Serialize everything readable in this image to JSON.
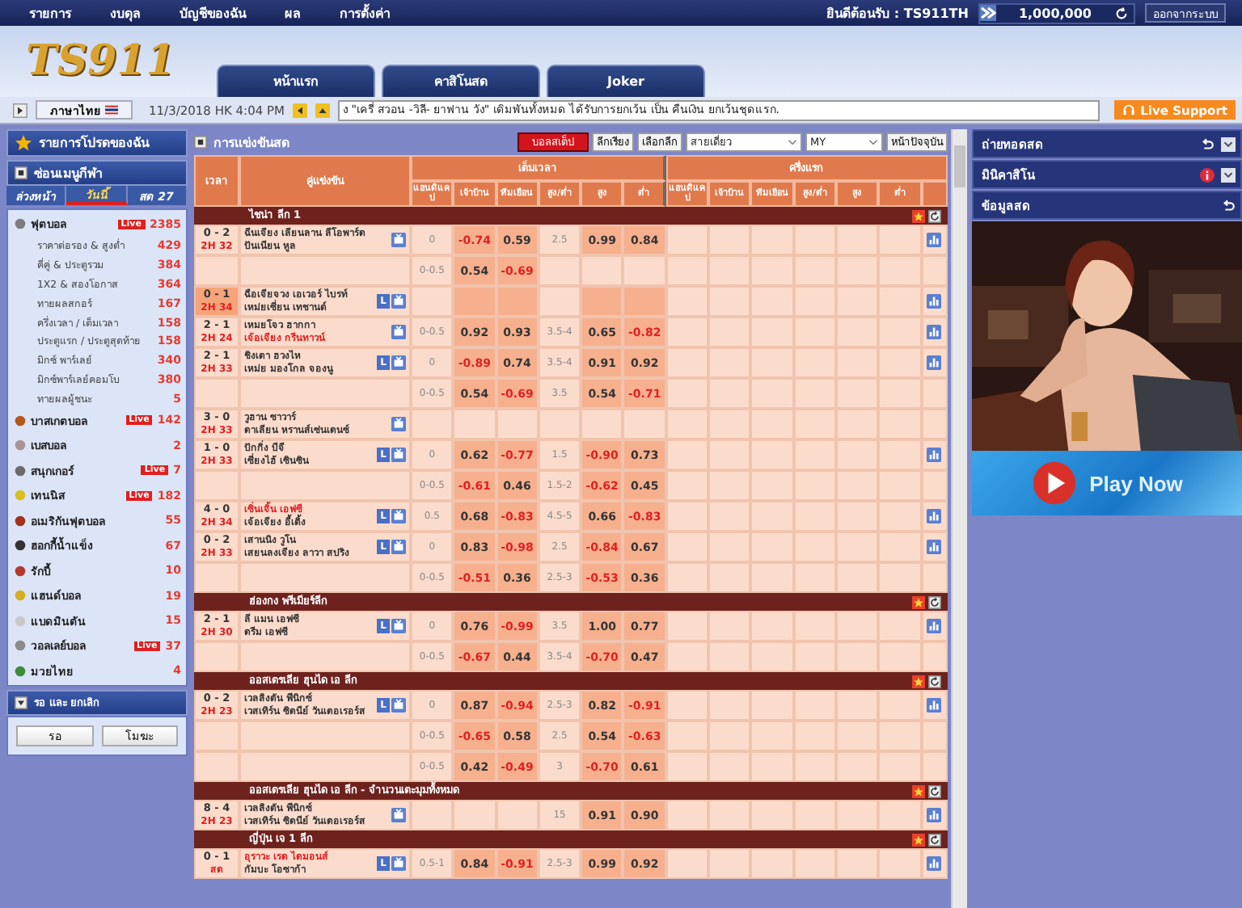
{
  "top_nav": {
    "items": [
      "รายการ",
      "งบดุล",
      "บัญชีของฉัน",
      "ผล",
      "การตั้งค่า"
    ],
    "welcome": "ยินดีต้อนรับ : TS911TH",
    "balance": "1,000,000",
    "logout": "ออกจากระบบ"
  },
  "logo": "TS911",
  "tabs": [
    {
      "label": "หน้าแรก"
    },
    {
      "label": "คาสิโนสด"
    },
    {
      "label": "Joker"
    }
  ],
  "ticker_bar": {
    "language": "ภาษาไทย",
    "datetime": "11/3/2018 HK 4:04 PM",
    "message": "ง \"เครี่ สวอน -วิลี- ยาฟาน วัง\" เดิมพันทั้งหมด ได้รับการยกเว้น เป็น คืนเงิน ยกเว้นชุดแรก.",
    "support": "Live Support"
  },
  "sidebar": {
    "favorites": "รายการโปรดของฉัน",
    "hide_menu": "ซ่อนเมนูกีฬา",
    "tabs": [
      {
        "label": "ล่วงหน้า",
        "selected": false
      },
      {
        "label": "วันนี้",
        "selected": true
      },
      {
        "label": "สด 27",
        "selected": false
      }
    ],
    "sports": [
      {
        "name": "ฟุตบอล",
        "count": "2385",
        "live": "Live",
        "color": "#7d7d7d",
        "children": [
          {
            "name": "ราคาต่อรอง & สูงต่ำ",
            "count": "429"
          },
          {
            "name": "คี่คู่ & ประตูรวม",
            "count": "384"
          },
          {
            "name": "1X2 & สองโอกาส",
            "count": "364"
          },
          {
            "name": "ทายผลสกอร์",
            "count": "167"
          },
          {
            "name": "ครึ่งเวลา / เต็มเวลา",
            "count": "158"
          },
          {
            "name": "ประตูแรก / ประตูสุดท้าย",
            "count": "158"
          },
          {
            "name": "มิกซ์ พาร์เลย์",
            "count": "340"
          },
          {
            "name": "มิกซ์พาร์เลย์คอมโบ",
            "count": "380"
          },
          {
            "name": "ทายผลผู้ชนะ",
            "count": "5"
          }
        ]
      },
      {
        "name": "บาสเกตบอล",
        "count": "142",
        "live": "Live",
        "color": "#b4561c"
      },
      {
        "name": "เบสบอล",
        "count": "2",
        "color": "#a89494"
      },
      {
        "name": "สนุกเกอร์",
        "count": "7",
        "live": "Live",
        "color": "#6b6b6b"
      },
      {
        "name": "เทนนิส",
        "count": "182",
        "live": "Live",
        "color": "#d8bf22"
      },
      {
        "name": "อเมริกันฟุตบอล",
        "count": "55",
        "color": "#a2321c"
      },
      {
        "name": "ฮอกกี้น้ำแข็ง",
        "count": "67",
        "color": "#333333"
      },
      {
        "name": "รักบี้",
        "count": "10",
        "color": "#b23a2e"
      },
      {
        "name": "แฮนด์บอล",
        "count": "19",
        "color": "#d9ad22"
      },
      {
        "name": "แบดมินตัน",
        "count": "15",
        "color": "#c8c8c8"
      },
      {
        "name": "วอลเลย์บอล",
        "count": "37",
        "live": "Live",
        "color": "#8c8c8c"
      },
      {
        "name": "มวยไทย",
        "count": "4",
        "color": "#3f8a3a"
      }
    ],
    "pending": {
      "title": "รอ และ ยกเลิก",
      "buttons": [
        "รอ",
        "โมฆะ"
      ]
    }
  },
  "main": {
    "title": "การแข่งขันสด",
    "toolbar": {
      "parlay": "บอลสเต็ป",
      "sort": "ลีกเรียง",
      "select_league": "เลือกลีก",
      "view": "สายเดี่ยว",
      "odds_type": "MY",
      "current_page": "หน้าปัจจุบัน"
    },
    "table": {
      "columns": [
        "เวลา",
        "คู่แข่งขัน"
      ],
      "groups": [
        {
          "label": "เต็มเวลา",
          "columns": [
            "แฮนดิแคป",
            "เจ้าบ้าน",
            "ทีมเยือน",
            "สูง/ต่ำ",
            "สูง",
            "ต่ำ"
          ]
        },
        {
          "label": "ครึ่งแรก",
          "columns": [
            "แฮนดิแคป",
            "เจ้าบ้าน",
            "ทีมเยือน",
            "สูง/ต่ำ",
            "สูง",
            "ต่ำ"
          ]
        }
      ],
      "leagues": [
        {
          "name": "ไชน่า ลีก 1",
          "matches": [
            {
              "score": "0 - 2",
              "time": "2H 32",
              "score_hl": false,
              "home": "ฉีนเจียง เลียนลาน ลีโอพาร์ด",
              "away": "ปันเนียน หูล",
              "home_red": false,
              "away_red": false,
              "lines": [
                {
                  "hdp": "0",
                  "home": "-0.74",
                  "away": "0.59",
                  "ou": "2.5",
                  "over": "0.99",
                  "under": "0.84"
                },
                {
                  "hdp": "0-0.5",
                  "home": "0.54",
                  "away": "-0.69"
                }
              ]
            },
            {
              "score": "0 - 1",
              "time": "2H 34",
              "score_hl": true,
              "home": "ฉือเจียจวง เอเวอร์ ไบรท์",
              "away": "เหม่ยเซี่ยน เทชานต์",
              "home_red": false,
              "away_red": false,
              "l": "L"
            },
            {
              "score": "2 - 1",
              "time": "2H 24",
              "score_hl": false,
              "home": "เหมยโจว ฮากกา",
              "away": "เจ้อเจียง กรีนทาวน์",
              "home_red": false,
              "away_red": true,
              "lines": [
                {
                  "hdp": "0-0.5",
                  "home": "0.92",
                  "away": "0.93",
                  "ou": "3.5-4",
                  "over": "0.65",
                  "under": "-0.82"
                }
              ]
            },
            {
              "score": "2 - 1",
              "time": "2H 33",
              "score_hl": false,
              "home": "ชิงเตา ฮวงไห",
              "away": "เหม่ย มองโกล จองนู",
              "home_red": false,
              "away_red": false,
              "l": "L",
              "lines": [
                {
                  "hdp": "0",
                  "home": "-0.89",
                  "away": "0.74",
                  "ou": "3.5-4",
                  "over": "0.91",
                  "under": "0.92"
                },
                {
                  "hdp": "0-0.5",
                  "home": "0.54",
                  "away": "-0.69",
                  "ou": "3.5",
                  "over": "0.54",
                  "under": "-0.71"
                }
              ]
            },
            {
              "score": "3 - 0",
              "time": "2H 33",
              "score_hl": false,
              "home": "วูฮาน ซาวาร์",
              "away": "ดาเลียน หรานส์เซ่นเดนซ์",
              "home_red": false,
              "away_red": false
            },
            {
              "score": "1 - 0",
              "time": "2H 33",
              "score_hl": false,
              "home": "ปักกิ่ง บีจี",
              "away": "เซี่ยงไฮ้ เซินซิน",
              "home_red": false,
              "away_red": false,
              "l": "L",
              "lines": [
                {
                  "hdp": "0",
                  "home": "0.62",
                  "away": "-0.77",
                  "ou": "1.5",
                  "over": "-0.90",
                  "under": "0.73"
                },
                {
                  "hdp": "0-0.5",
                  "home": "-0.61",
                  "away": "0.46",
                  "ou": "1.5-2",
                  "over": "-0.62",
                  "under": "0.45"
                }
              ]
            },
            {
              "score": "4 - 0",
              "time": "2H 34",
              "score_hl": false,
              "home": "เซิ่นเจิ้น เอฟซี",
              "away": "เจ้อเจียง อี้เติ้ง",
              "home_red": true,
              "away_red": false,
              "l": "L",
              "lines": [
                {
                  "hdp": "0.5",
                  "home": "0.68",
                  "away": "-0.83",
                  "ou": "4.5-5",
                  "over": "0.66",
                  "under": "-0.83"
                }
              ]
            },
            {
              "score": "0 - 2",
              "time": "2H 33",
              "score_hl": false,
              "home": "เสานนิง วูโน",
              "away": "เสยนลงเจียง ลาวา สปริง",
              "home_red": false,
              "away_red": false,
              "l": "L",
              "lines": [
                {
                  "hdp": "0",
                  "home": "0.83",
                  "away": "-0.98",
                  "ou": "2.5",
                  "over": "-0.84",
                  "under": "0.67"
                },
                {
                  "hdp": "0-0.5",
                  "home": "-0.51",
                  "away": "0.36",
                  "ou": "2.5-3",
                  "over": "-0.53",
                  "under": "0.36"
                }
              ]
            }
          ]
        },
        {
          "name": "ฮ่องกง พรีเมียร์ลีก",
          "matches": [
            {
              "score": "2 - 1",
              "time": "2H 30",
              "score_hl": false,
              "home": "ลี แมน เอฟซี",
              "away": "ดรีม เอฟซี",
              "home_red": false,
              "away_red": false,
              "l": "L",
              "lines": [
                {
                  "hdp": "0",
                  "home": "0.76",
                  "away": "-0.99",
                  "ou": "3.5",
                  "over": "1.00",
                  "under": "0.77"
                },
                {
                  "hdp": "0-0.5",
                  "home": "-0.67",
                  "away": "0.44",
                  "ou": "3.5-4",
                  "over": "-0.70",
                  "under": "0.47"
                }
              ]
            }
          ]
        },
        {
          "name": "ออสเตรเลีย ฮุนได เอ ลีก",
          "matches": [
            {
              "score": "0 - 2",
              "time": "2H 23",
              "score_hl": false,
              "home": "เวลลิงตัน ฟีนิกซ์",
              "away": "เวสเทิร์น ซิดนีย์ วันเดอเรอร์ส",
              "home_red": false,
              "away_red": false,
              "l": "L",
              "lines": [
                {
                  "hdp": "0",
                  "home": "0.87",
                  "away": "-0.94",
                  "ou": "2.5-3",
                  "over": "0.82",
                  "under": "-0.91"
                },
                {
                  "hdp": "0-0.5",
                  "home": "-0.65",
                  "away": "0.58",
                  "ou": "2.5",
                  "over": "0.54",
                  "under": "-0.63"
                },
                {
                  "hdp": "0-0.5",
                  "home": "0.42",
                  "away": "-0.49",
                  "ou": "3",
                  "over": "-0.70",
                  "under": "0.61"
                }
              ]
            }
          ]
        },
        {
          "name": "ออสเตรเลีย ฮุนได เอ ลีก - จำนวนเตะมุมทั้งหมด",
          "matches": [
            {
              "score": "8 - 4",
              "time": "2H 23",
              "score_hl": false,
              "home": "เวลลิงตัน ฟีนิกซ์",
              "away": "เวสเทิร์น ซิดนีย์ วันเดอเรอร์ส",
              "home_red": false,
              "away_red": false,
              "lines": [
                {
                  "ou": "15",
                  "over": "0.91",
                  "under": "0.90"
                }
              ]
            }
          ]
        },
        {
          "name": "ญี่ปุ่น เจ 1 ลีก",
          "matches": [
            {
              "score": "0 - 1",
              "time": "สด",
              "score_hl": false,
              "home": "อุราวะ เรด ไดมอนส์",
              "away": "กัมบะ โอซาก้า",
              "home_red": true,
              "away_red": false,
              "l": "L",
              "lines": [
                {
                  "hdp": "0.5-1",
                  "home": "0.84",
                  "away": "-0.91",
                  "ou": "2.5-3",
                  "over": "0.99",
                  "under": "0.92"
                }
              ]
            }
          ]
        }
      ]
    }
  },
  "right_panel": {
    "sections": [
      {
        "title": "ถ่ายทอดสด",
        "refresh": true,
        "info": false,
        "collapse": true
      },
      {
        "title": "มินิคาสิโน",
        "refresh": false,
        "info": true,
        "collapse": true
      },
      {
        "title": "ข้อมูลสด",
        "refresh": true,
        "info": false,
        "collapse": false
      }
    ],
    "play_now": "Play Now"
  }
}
